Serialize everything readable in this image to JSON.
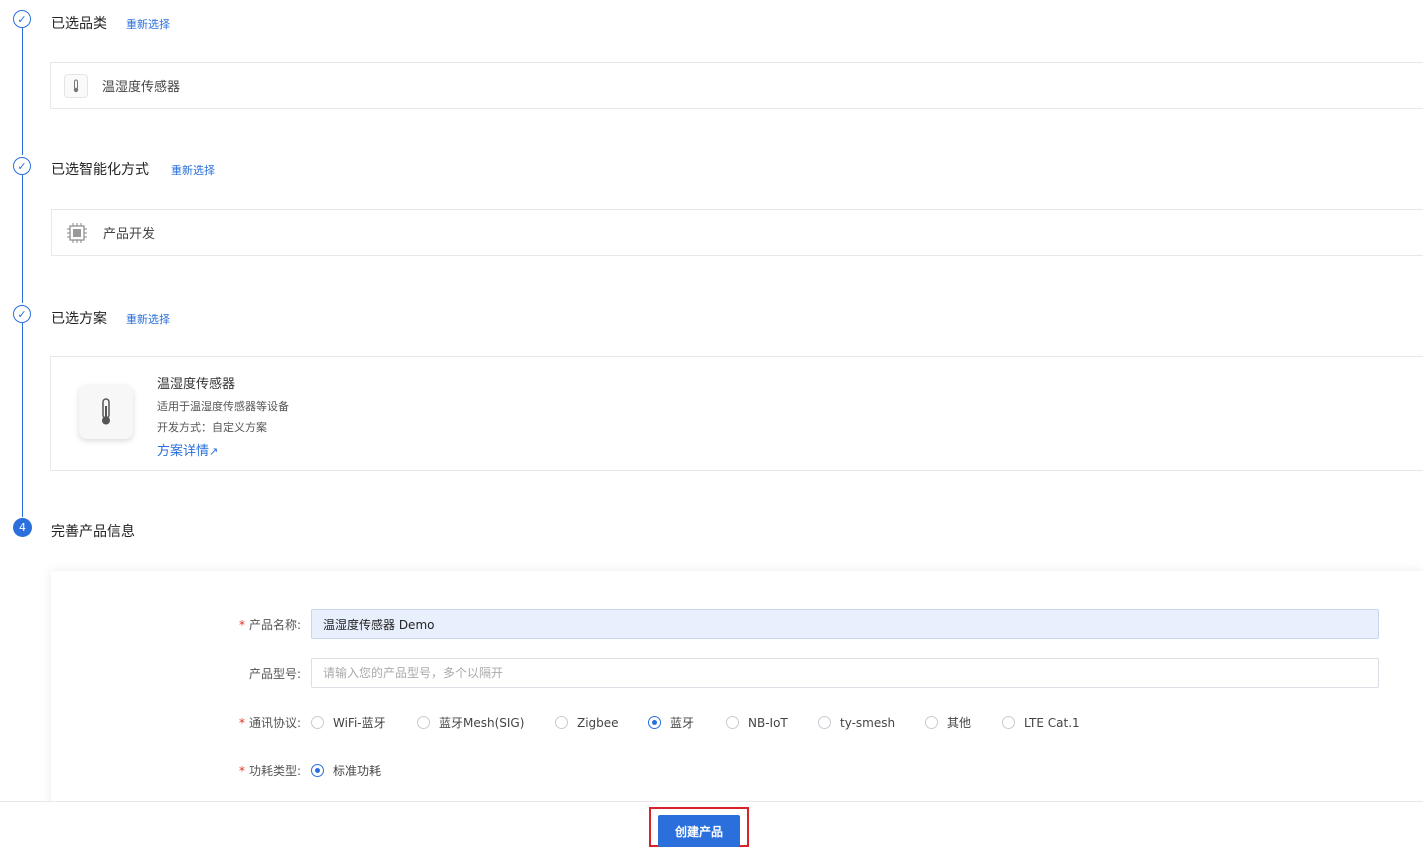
{
  "steps": [
    {
      "title": "已选品类",
      "relink": "重新选择"
    },
    {
      "title": "已选智能化方式",
      "relink": "重新选择"
    },
    {
      "title": "已选方案",
      "relink": "重新选择"
    },
    {
      "title": "完善产品信息",
      "number": "4"
    }
  ],
  "category": {
    "name": "温湿度传感器",
    "icon": "thermometer-icon"
  },
  "method": {
    "name": "产品开发",
    "icon": "chip-icon"
  },
  "plan": {
    "name": "温湿度传感器",
    "desc": "适用于温湿度传感器等设备",
    "method_label": "开发方式：自定义方案",
    "detail_link": "方案详情",
    "icon": "thermometer-icon"
  },
  "form": {
    "name_label": "产品名称:",
    "name_value": "温湿度传感器 Demo",
    "model_label": "产品型号:",
    "model_placeholder": "请输入您的产品型号，多个以隔开",
    "protocol_label": "通讯协议:",
    "protocols": [
      "WiFi-蓝牙",
      "蓝牙Mesh(SIG)",
      "Zigbee",
      "蓝牙",
      "NB-IoT",
      "ty-smesh",
      "其他",
      "LTE Cat.1"
    ],
    "protocol_selected": "蓝牙",
    "power_label": "功耗类型:",
    "power_options": [
      "标准功耗"
    ],
    "power_selected": "标准功耗"
  },
  "footer": {
    "create_label": "创建产品"
  },
  "colors": {
    "accent": "#2a6fdb",
    "highlight": "#d8232a",
    "required": "#e0302a"
  }
}
